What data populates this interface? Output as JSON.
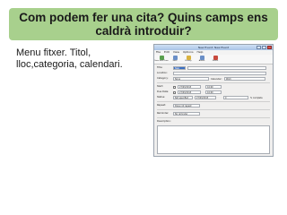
{
  "slide": {
    "title": "Com podem fer una cita? Quins camps ens caldrà introduir?",
    "body": "Menu fitxer. Titol, lloc,categoria, calendari."
  },
  "dialog": {
    "window_title": "New Event: New Event",
    "menu": [
      "File",
      "Edit",
      "View",
      "Options",
      "Help"
    ],
    "toolbar": [
      "Save and Close",
      "Save",
      "Privacy",
      "Attach",
      "Delete"
    ],
    "fields": {
      "title_label": "Title:",
      "title_value": "New Event",
      "location_label": "Location:",
      "category_label": "Category:",
      "category_value": "None",
      "calendar_label": "Calendar:",
      "calendar_value": "Work",
      "start_label": "Start:",
      "start_date": "27/03/2013",
      "start_time": "16:00",
      "end_label": "Due Date:",
      "end_date": "27/03/2013",
      "end_time": "16:00",
      "status_label": "Status:",
      "status_value": "Not specified",
      "status_date": "27/03/2013",
      "percent": "0",
      "percent_suffix": "% complete",
      "repeat_label": "Repeat:",
      "repeat_value": "Does not repeat",
      "reminder_label": "Reminder:",
      "reminder_value": "No reminder",
      "description_label": "Description:"
    }
  }
}
